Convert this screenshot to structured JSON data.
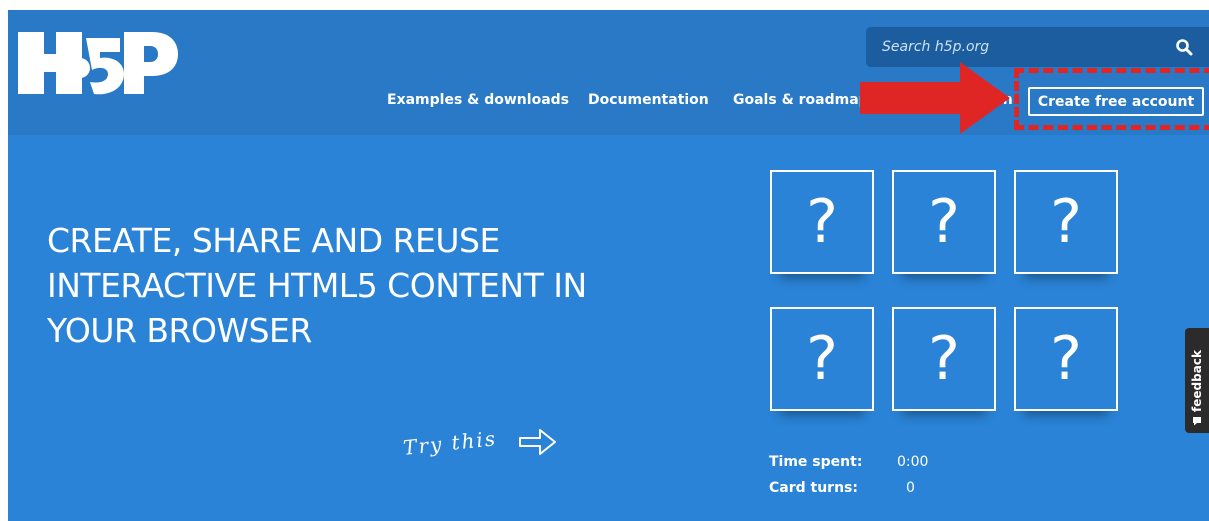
{
  "header": {
    "search": {
      "placeholder": "Search h5p.org"
    },
    "nav": [
      {
        "label": "Examples & downloads"
      },
      {
        "label": "Documentation"
      },
      {
        "label": "Goals & roadmap"
      },
      {
        "label": "in"
      }
    ],
    "cta": {
      "label": "Create free account"
    }
  },
  "hero": {
    "headline": "CREATE, SHARE AND REUSE INTERACTIVE HTML5 CONTENT IN YOUR BROWSER",
    "try_label": "Try this"
  },
  "game": {
    "cards": [
      "?",
      "?",
      "?",
      "?",
      "?",
      "?"
    ],
    "time_label": "Time spent:",
    "time_value": "0:00",
    "turns_label": "Card turns:",
    "turns_value": "0"
  },
  "feedback_tab": {
    "label": "feedback"
  },
  "colors": {
    "page_bg": "#2a83d6",
    "header_bg": "#2a79c6",
    "search_bg": "#1b5d9e",
    "annotation_red": "#e02525",
    "feedback_bg": "#2b2b2b"
  }
}
